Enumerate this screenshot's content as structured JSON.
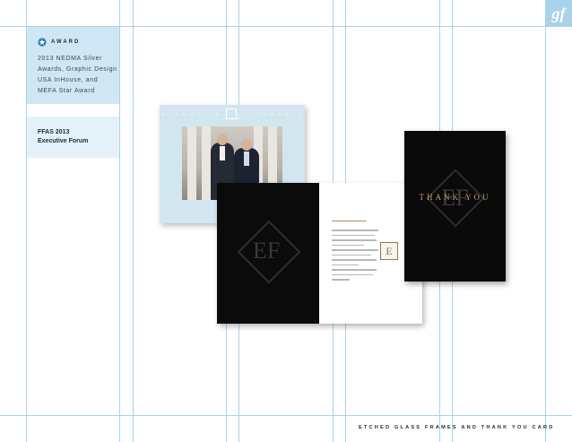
{
  "brand": {
    "corner_logo": "gf"
  },
  "award": {
    "label": "AWARD",
    "icon": "award-rosette-icon",
    "text": "2013 NEDMA Silver Awards, Graphic Design USA InHouse, and MEFA Star Award"
  },
  "project": {
    "title_line1": "FFAS 2013",
    "title_line2": "Executive Forum"
  },
  "frame": {
    "logo": "Fidelity"
  },
  "folder": {
    "monogram": "EF"
  },
  "card": {
    "monogram": "EF",
    "text": "THANK YOU"
  },
  "caption": "ETCHED GLASS FRAMES AND THANK YOU CARD",
  "colors": {
    "grid": "#a9d3ea",
    "award_bg": "#cfe7f4",
    "forum_bg": "#e4f1f9",
    "gold": "#c2a46e"
  }
}
